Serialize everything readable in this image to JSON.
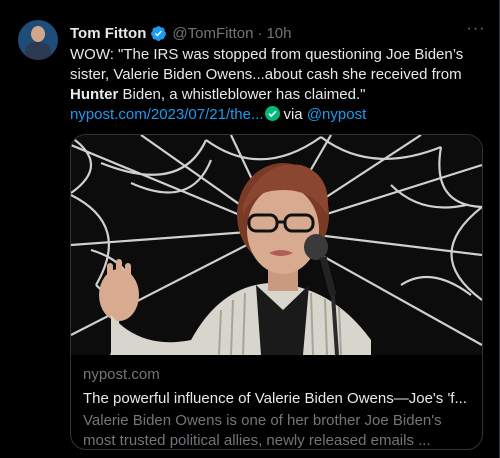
{
  "tweet": {
    "author_name": "Tom Fitton",
    "handle": "@TomFitton",
    "separator": "·",
    "time": "10h",
    "text_line1": "WOW: \"The IRS was stopped from questioning Joe Biden’s",
    "text_line2": "sister, Valerie Biden Owens...about cash she received from",
    "text_line3_bold": "Hunter",
    "text_line3_rest": " Biden, a whistleblower has claimed.\"",
    "link_text": "nypost.com/2023/07/21/the...",
    "via_text": "via",
    "via_handle": "@nypost",
    "more_label": "···"
  },
  "card": {
    "domain": "nypost.com",
    "title": "The powerful influence of Valerie Biden Owens—Joe's 'f...",
    "desc_line1": "Valerie Biden Owens is one of her brother Joe Biden's",
    "desc_line2": "most trusted political allies, newly released emails ..."
  },
  "colors": {
    "background": "#000000",
    "text": "#e7e9ea",
    "secondary": "#71767b",
    "link": "#1d9bf0",
    "verified": "#1d9bf0",
    "check_green": "#00ba7c"
  },
  "icons": {
    "verified": "verified-badge-icon",
    "more": "more-options-icon",
    "link_check": "check-circle-icon"
  }
}
